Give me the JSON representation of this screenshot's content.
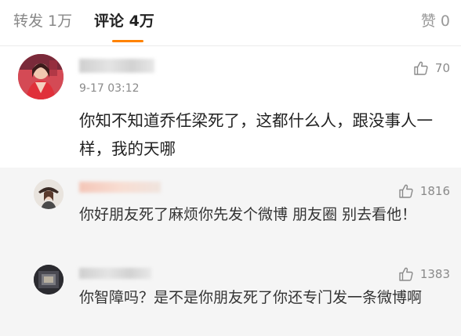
{
  "tabs": {
    "repost_label": "转发 1万",
    "comments_label": "评论 4万",
    "likes_label": "赞 0",
    "active_color": "#ff8200"
  },
  "main_comment": {
    "time": "9-17 03:12",
    "like_count": "70",
    "text": "你知不知道乔任梁死了，这都什么人，跟没事人一样，我的天哪"
  },
  "replies": [
    {
      "like_count": "1816",
      "text": "你好朋友死了麻烦你先发个微博 朋友圈 别去看他！"
    },
    {
      "like_count": "1383",
      "text": "你智障吗？是不是你朋友死了你还专门发一条微博啊"
    }
  ],
  "icons": {
    "like": "thumbs-up-icon"
  }
}
